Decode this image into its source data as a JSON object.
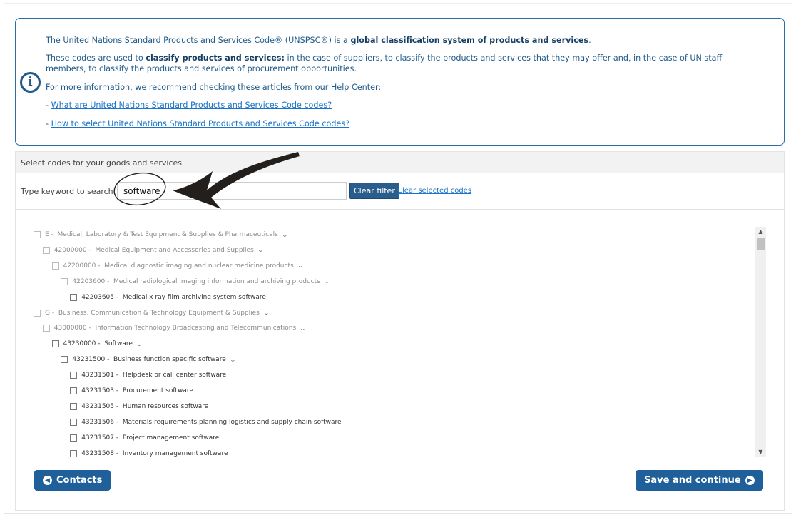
{
  "info": {
    "p1_pre": "The United Nations Standard Products and Services Code® (UNSPSC®) is a ",
    "p1_bold": "global classification system of products and services",
    "p1_post": ".",
    "p2_pre": "These codes are used to ",
    "p2_bold": "classify products and services:",
    "p2_post": " in the case of suppliers, to classify the products and services that they may offer and, in the case of UN staff members, to classify the products and services of procurement opportunities.",
    "p3": "For more information, we recommend checking these articles from our Help Center:",
    "link1": "What are United Nations Standard Products and Services Code codes?",
    "link2": "How to select United Nations Standard Products and Services Code codes?",
    "dash": "- "
  },
  "panel": {
    "header": "Select codes for your goods and services",
    "search_label": "Type keyword to search:",
    "search_value": "software",
    "clear_filter": "Clear filter",
    "clear_selected": "Clear selected codes"
  },
  "tree": [
    {
      "level": 0,
      "code": "E",
      "name": "Medical, Laboratory & Test Equipment & Supplies & Pharmaceuticals",
      "muted": true,
      "expandable": true
    },
    {
      "level": 1,
      "code": "42000000",
      "name": "Medical Equipment and Accessories and Supplies",
      "muted": true,
      "expandable": true
    },
    {
      "level": 2,
      "code": "42200000",
      "name": "Medical diagnostic imaging and nuclear medicine products",
      "muted": true,
      "expandable": true
    },
    {
      "level": 3,
      "code": "42203600",
      "name": "Medical radiological imaging information and archiving products",
      "muted": true,
      "expandable": true
    },
    {
      "level": 4,
      "code": "42203605",
      "name": "Medical x ray film archiving system software",
      "muted": false,
      "expandable": false
    },
    {
      "level": 0,
      "code": "G",
      "name": "Business, Communication & Technology Equipment & Supplies",
      "muted": true,
      "expandable": true
    },
    {
      "level": 1,
      "code": "43000000",
      "name": "Information Technology Broadcasting and Telecommunications",
      "muted": true,
      "expandable": true
    },
    {
      "level": 2,
      "code": "43230000",
      "name": "Software",
      "muted": false,
      "expandable": true
    },
    {
      "level": 3,
      "code": "43231500",
      "name": "Business function specific software",
      "muted": false,
      "expandable": true
    },
    {
      "level": 4,
      "code": "43231501",
      "name": "Helpdesk or call center software",
      "muted": false,
      "expandable": false
    },
    {
      "level": 4,
      "code": "43231503",
      "name": "Procurement software",
      "muted": false,
      "expandable": false
    },
    {
      "level": 4,
      "code": "43231505",
      "name": "Human resources software",
      "muted": false,
      "expandable": false
    },
    {
      "level": 4,
      "code": "43231506",
      "name": "Materials requirements planning logistics and supply chain software",
      "muted": false,
      "expandable": false
    },
    {
      "level": 4,
      "code": "43231507",
      "name": "Project management software",
      "muted": false,
      "expandable": false
    },
    {
      "level": 4,
      "code": "43231508",
      "name": "Inventory management software",
      "muted": false,
      "expandable": false
    }
  ],
  "footer": {
    "back": "Contacts",
    "next": "Save and continue"
  },
  "colors": {
    "primary": "#1f5f9a",
    "link": "#1a73c8",
    "info_border": "#2a6ea8"
  }
}
